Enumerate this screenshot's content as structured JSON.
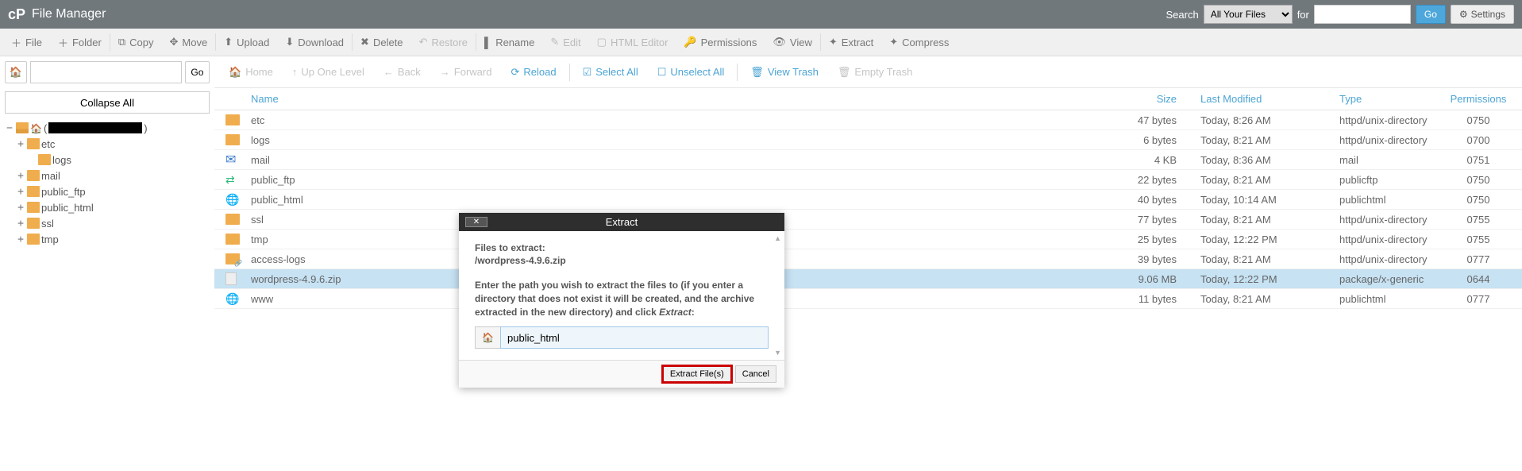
{
  "header": {
    "app_title": "File Manager",
    "search_label": "Search",
    "search_scope": "All Your Files",
    "for_label": "for",
    "go": "Go",
    "settings": "Settings"
  },
  "toolbar": {
    "file": "File",
    "folder": "Folder",
    "copy": "Copy",
    "move": "Move",
    "upload": "Upload",
    "download": "Download",
    "delete": "Delete",
    "restore": "Restore",
    "rename": "Rename",
    "edit": "Edit",
    "html_editor": "HTML Editor",
    "permissions": "Permissions",
    "view": "View",
    "extract": "Extract",
    "compress": "Compress"
  },
  "nav": {
    "go": "Go",
    "collapse_all": "Collapse All"
  },
  "secondary": {
    "home": "Home",
    "up": "Up One Level",
    "back": "Back",
    "forward": "Forward",
    "reload": "Reload",
    "select_all": "Select All",
    "unselect_all": "Unselect All",
    "view_trash": "View Trash",
    "empty_trash": "Empty Trash"
  },
  "tree": {
    "root_prefix": "(",
    "items": [
      "etc",
      "logs",
      "mail",
      "public_ftp",
      "public_html",
      "ssl",
      "tmp"
    ]
  },
  "table": {
    "headers": {
      "name": "Name",
      "size": "Size",
      "mod": "Last Modified",
      "type": "Type",
      "perm": "Permissions"
    },
    "rows": [
      {
        "icon": "folder",
        "name": "etc",
        "size": "47 bytes",
        "mod": "Today, 8:26 AM",
        "type": "httpd/unix-directory",
        "perm": "0750"
      },
      {
        "icon": "folder",
        "name": "logs",
        "size": "6 bytes",
        "mod": "Today, 8:21 AM",
        "type": "httpd/unix-directory",
        "perm": "0700"
      },
      {
        "icon": "mail",
        "name": "mail",
        "size": "4 KB",
        "mod": "Today, 8:36 AM",
        "type": "mail",
        "perm": "0751"
      },
      {
        "icon": "pub",
        "name": "public_ftp",
        "size": "22 bytes",
        "mod": "Today, 8:21 AM",
        "type": "publicftp",
        "perm": "0750"
      },
      {
        "icon": "globe",
        "name": "public_html",
        "size": "40 bytes",
        "mod": "Today, 10:14 AM",
        "type": "publichtml",
        "perm": "0750"
      },
      {
        "icon": "folder",
        "name": "ssl",
        "size": "77 bytes",
        "mod": "Today, 8:21 AM",
        "type": "httpd/unix-directory",
        "perm": "0755"
      },
      {
        "icon": "folder",
        "name": "tmp",
        "size": "25 bytes",
        "mod": "Today, 12:22 PM",
        "type": "httpd/unix-directory",
        "perm": "0755"
      },
      {
        "icon": "folderlink",
        "name": "access-logs",
        "size": "39 bytes",
        "mod": "Today, 8:21 AM",
        "type": "httpd/unix-directory",
        "perm": "0777"
      },
      {
        "icon": "file",
        "name": "wordpress-4.9.6.zip",
        "size": "9.06 MB",
        "mod": "Today, 12:22 PM",
        "type": "package/x-generic",
        "perm": "0644",
        "selected": true
      },
      {
        "icon": "globelink",
        "name": "www",
        "size": "11 bytes",
        "mod": "Today, 8:21 AM",
        "type": "publichtml",
        "perm": "0777"
      }
    ]
  },
  "modal": {
    "title": "Extract",
    "files_label": "Files to extract:",
    "files_value": "/wordpress-4.9.6.zip",
    "instruction_1": "Enter the path you wish to extract the files to (if you enter a directory that does not exist it will be created, and the archive extracted in the new directory) and click ",
    "instruction_em": "Extract",
    "instruction_colon": ":",
    "path_value": "public_html",
    "extract_btn": "Extract File(s)",
    "cancel_btn": "Cancel"
  }
}
